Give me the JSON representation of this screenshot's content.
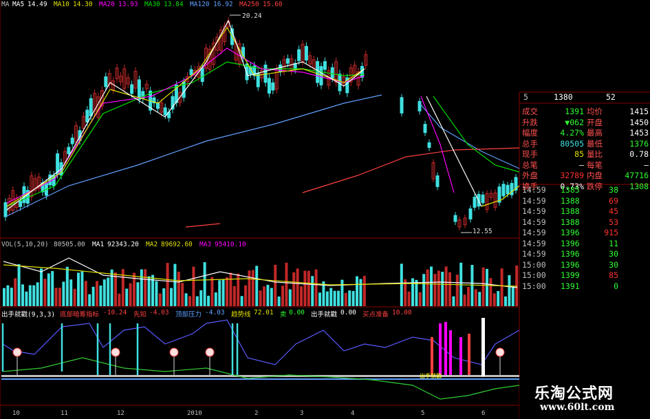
{
  "colors": {
    "up": "#c02828",
    "down": "#40e0e0",
    "ma5": "#ffffff",
    "ma10": "#e0e000",
    "ma20": "#ff00ff",
    "ma30": "#00e000",
    "ma120": "#5fa0ff",
    "ma250": "#ff4040",
    "yellow": "#ffff00",
    "grey": "#c0c0c0",
    "osc": "#5a5aff",
    "osc2": "#33cc33",
    "red": "#ff3030",
    "green": "#30ff30",
    "white": "#ffffff"
  },
  "main_legend": [
    {
      "label": "MA",
      "value": "",
      "color": "#c0c0c0"
    },
    {
      "label": "MA5",
      "value": "14.49",
      "color": "#ffffff"
    },
    {
      "label": "MA10",
      "value": "14.30",
      "color": "#e0e000"
    },
    {
      "label": "MA20",
      "value": "13.93",
      "color": "#ff00ff"
    },
    {
      "label": "MA30",
      "value": "13.84",
      "color": "#00e000"
    },
    {
      "label": "MA120",
      "value": "16.92",
      "color": "#5fa0ff"
    },
    {
      "label": "MA250",
      "value": "15.60",
      "color": "#ff4040"
    }
  ],
  "price_high_label": "20.24",
  "price_low_label": "12.55",
  "vol_legend": [
    {
      "label": "VOL(5,10,20)",
      "value": "80505.00",
      "color": "#c0c0c0"
    },
    {
      "label": "MA1",
      "value": "92343.20",
      "color": "#ffffff"
    },
    {
      "label": "MA2",
      "value": "89692.60",
      "color": "#e0e000"
    },
    {
      "label": "MA3",
      "value": "95410.10",
      "color": "#ff00ff"
    }
  ],
  "ind_legend": [
    {
      "label": "出手就戳(9,3,3)",
      "color": "#ffffff"
    },
    {
      "label": "底部暗筹指标",
      "value": "-10.24",
      "color": "#ff4040"
    },
    {
      "label": "先知",
      "value": "-4.03",
      "color": "#ff4040"
    },
    {
      "label": "顶部压力",
      "value": "-4.03",
      "color": "#5fa0ff"
    },
    {
      "label": "趋势线",
      "value": "72.01",
      "color": "#e0e000"
    },
    {
      "label": "卖",
      "value": "0.00",
      "color": "#30ff30"
    },
    {
      "label": "出手就戳",
      "value": "0.00",
      "color": "#ffffff"
    },
    {
      "label": "买点准备",
      "value": "10.00",
      "color": "#ff4040"
    }
  ],
  "buy_marker": "出手就戳",
  "x_axis_labels": [
    "10",
    "11",
    "12",
    "2010",
    "2",
    "3",
    "4",
    "5",
    "6"
  ],
  "quote": {
    "top_row": {
      "a": "5",
      "b": "1380",
      "c": "52"
    },
    "rows": [
      {
        "l1": "成交",
        "v1": "1391",
        "l2": "均价",
        "v2": "1415",
        "c1": "#30ff30",
        "c2": "#ffffff"
      },
      {
        "l1": "升跌",
        "v1": "▼062",
        "l2": "开盘",
        "v2": "1450",
        "c1": "#30ff30",
        "c2": "#ffffff"
      },
      {
        "l1": "幅度",
        "v1": "4.27%",
        "l2": "最高",
        "v2": "1453",
        "c1": "#30ff30",
        "c2": "#ffffff"
      },
      {
        "l1": "总手",
        "v1": "80505",
        "l2": "最低",
        "v2": "1376",
        "c1": "#40e0e0",
        "c2": "#30ff30"
      },
      {
        "l1": "现手",
        "v1": "85",
        "l2": "量比",
        "v2": "0.78",
        "c1": "#e0e000",
        "c2": "#ffffff"
      },
      {
        "l1": "总笔",
        "v1": "—",
        "l2": "每笔",
        "v2": "—",
        "c1": "#ffffff",
        "c2": "#ffffff"
      },
      {
        "l1": "外盘",
        "v1": "32789",
        "l2": "内盘",
        "v2": "47716",
        "c1": "#ff3030",
        "c2": "#30ff30"
      },
      {
        "l1": "换手",
        "v1": "0.73%",
        "l2": "跌停",
        "v2": "1308",
        "c1": "#ffffff",
        "c2": "#30ff30"
      }
    ],
    "ticks": [
      {
        "t": "14:59",
        "p": "1385",
        "v": "38",
        "vc": "#30ff30"
      },
      {
        "t": "14:59",
        "p": "1388",
        "v": "69",
        "vc": "#ff3030"
      },
      {
        "t": "14:59",
        "p": "1388",
        "v": "45",
        "vc": "#ff3030"
      },
      {
        "t": "14:59",
        "p": "1388",
        "v": "53",
        "vc": "#ff3030"
      },
      {
        "t": "14:59",
        "p": "1396",
        "v": "915",
        "vc": "#ff3030"
      },
      {
        "t": "14:59",
        "p": "1396",
        "v": "11",
        "vc": "#30ff30"
      },
      {
        "t": "14:59",
        "p": "1396",
        "v": "30",
        "vc": "#30ff30"
      },
      {
        "t": "15:00",
        "p": "1396",
        "v": "30",
        "vc": "#30ff30"
      },
      {
        "t": "15:00",
        "p": "1399",
        "v": "85",
        "vc": "#ff3030"
      },
      {
        "t": "15:00",
        "p": "1391",
        "v": "0",
        "vc": "#30ff30"
      }
    ]
  },
  "brand": {
    "cn": "乐淘公式网",
    "url": "www.60lt.com"
  }
}
